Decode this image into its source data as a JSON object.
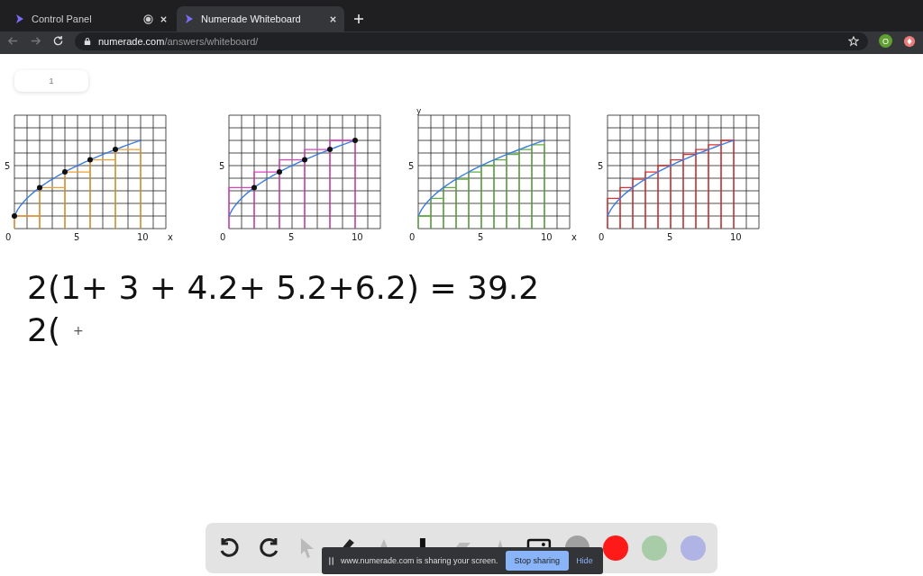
{
  "tabs": [
    {
      "title": "Control Panel",
      "selected": false,
      "recording": true
    },
    {
      "title": "Numerade Whiteboard",
      "selected": true,
      "recording": false
    }
  ],
  "address": {
    "domain": "numerade.com",
    "path": "/answers/whiteboard/"
  },
  "profile": {
    "initial": "O"
  },
  "page_indicator": "1",
  "graphs": [
    {
      "kind": "left-coarse",
      "color": "#f0a030",
      "y_tick": "5",
      "x_ticks": [
        "0",
        "5",
        "10"
      ],
      "x_axis": "x"
    },
    {
      "kind": "right-coarse",
      "color": "#e040c0",
      "y_tick": "5",
      "x_ticks": [
        "0",
        "5",
        "10"
      ]
    },
    {
      "kind": "left-fine",
      "color": "#60b040",
      "y_tick": "5",
      "x_ticks": [
        "0",
        "5",
        "10"
      ],
      "x_axis": "x",
      "y_axis": "y"
    },
    {
      "kind": "right-fine",
      "color": "#e03030",
      "y_tick": "5",
      "x_ticks": [
        "0",
        "5",
        "10"
      ]
    }
  ],
  "equations": [
    {
      "parts": [
        "2(1+ 3 + 4.2+ 5.2+6.2) = 39.2"
      ]
    },
    {
      "parts": [
        "2(",
        "+"
      ]
    }
  ],
  "tools": [
    {
      "kind": "undo",
      "disabled": false
    },
    {
      "kind": "redo",
      "disabled": false
    },
    {
      "kind": "pointer",
      "disabled": true
    },
    {
      "kind": "pencil",
      "disabled": false
    },
    {
      "kind": "marker",
      "disabled": true
    },
    {
      "kind": "stamp",
      "disabled": false
    },
    {
      "kind": "eraser",
      "disabled": true
    },
    {
      "kind": "highlighter",
      "disabled": true
    },
    {
      "kind": "image",
      "disabled": false
    }
  ],
  "colors": [
    {
      "color": "#a0a0a0"
    },
    {
      "color": "#ff1a1a"
    },
    {
      "color": "#a8cca8"
    },
    {
      "color": "#b0b4e4"
    }
  ],
  "share_bar": {
    "message": "www.numerade.com is sharing your screen.",
    "stop": "Stop sharing",
    "hide": "Hide"
  }
}
